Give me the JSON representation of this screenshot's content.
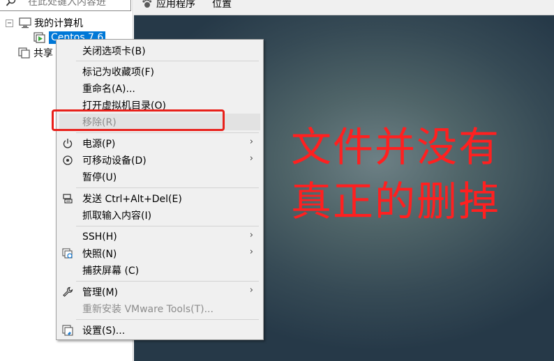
{
  "library": {
    "search_placeholder": "在此处键入内容进",
    "root_label": "我的计算机",
    "vm_label": "Centos 7.6",
    "shared_label": "共享"
  },
  "toolbar": {
    "apps_label": "应用程序",
    "places_label": "位置"
  },
  "context_menu": {
    "items": [
      {
        "label": "关闭选项卡(B)"
      },
      {
        "label": "标记为收藏项(F)"
      },
      {
        "label": "重命名(A)..."
      },
      {
        "label": "打开虚拟机目录(O)"
      },
      {
        "label": "移除(R)"
      },
      {
        "label": "电源(P)"
      },
      {
        "label": "可移动设备(D)"
      },
      {
        "label": "暂停(U)"
      },
      {
        "label": "发送 Ctrl+Alt+Del(E)"
      },
      {
        "label": "抓取输入内容(I)"
      },
      {
        "label": "SSH(H)"
      },
      {
        "label": "快照(N)"
      },
      {
        "label": "捕获屏幕 (C)"
      },
      {
        "label": "管理(M)"
      },
      {
        "label": "重新安装 VMware Tools(T)..."
      },
      {
        "label": "设置(S)..."
      }
    ]
  },
  "annotation": {
    "line1": "文件并没有",
    "line2": "真正的删掉",
    "color": "#ff2020"
  }
}
